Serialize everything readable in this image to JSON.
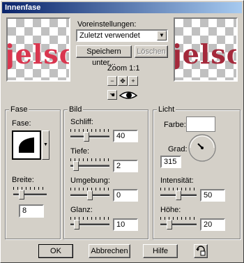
{
  "window": {
    "title": "Innenfase"
  },
  "preview": {
    "word_before": "jelsc",
    "word_after": "jelsc"
  },
  "presets": {
    "label": "Voreinstellungen:",
    "selected": "Zuletzt verwendet",
    "save_label": "Speichern unter...",
    "delete_label": "Löschen"
  },
  "zoom": {
    "label": "Zoom 1:1"
  },
  "fase": {
    "group_label": "Fase",
    "shape_label": "Fase:",
    "width_label": "Breite:",
    "width_value": "8",
    "width_level": 0.2
  },
  "bild": {
    "group_label": "Bild",
    "schliff_label": "Schliff:",
    "schliff_value": "40",
    "schliff_level": 0.4,
    "tiefe_label": "Tiefe:",
    "tiefe_value": "2",
    "tiefe_level": 0.08,
    "umgebung_label": "Umgebung:",
    "umgebung_value": "0",
    "umgebung_level": 0.5,
    "glanz_label": "Glanz:",
    "glanz_value": "10",
    "glanz_level": 0.1
  },
  "licht": {
    "group_label": "Licht",
    "farbe_label": "Farbe:",
    "grad_label": "Grad:",
    "grad_value": "315",
    "intensitaet_label": "Intensität:",
    "intensitaet_value": "50",
    "intensitaet_level": 0.5,
    "hoehe_label": "Höhe:",
    "hoehe_value": "20",
    "hoehe_level": 0.2
  },
  "footer": {
    "ok_label": "OK",
    "cancel_label": "Abbrechen",
    "help_label": "Hilfe"
  },
  "colors": {
    "accent": "#0a246a",
    "text_red": "#cc1133",
    "face": "#d4d0c8"
  }
}
